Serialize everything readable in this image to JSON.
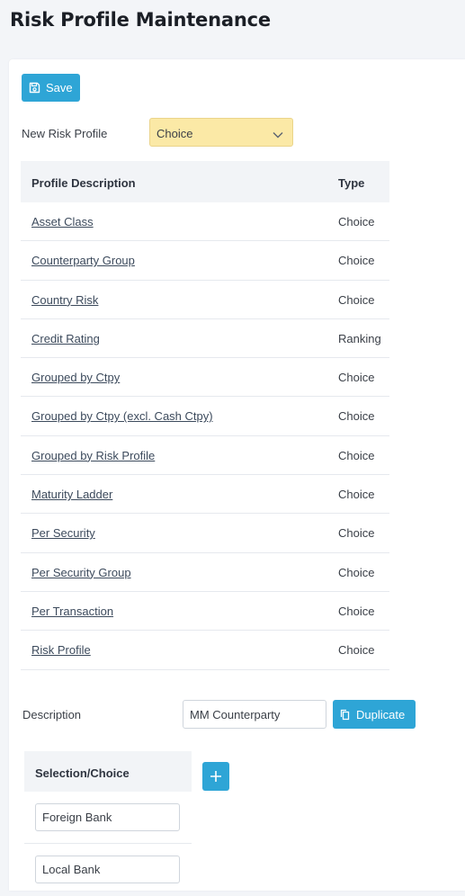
{
  "page": {
    "title": "Risk Profile Maintenance"
  },
  "toolbar": {
    "save_label": "Save",
    "save_icon": "floppy-disk-icon"
  },
  "new_profile": {
    "label": "New Risk Profile",
    "selected": "Choice",
    "icon": "chevron-down-icon"
  },
  "profiles": {
    "headers": {
      "description": "Profile Description",
      "type": "Type"
    },
    "rows": [
      {
        "description": "Asset Class",
        "type": "Choice"
      },
      {
        "description": "Counterparty Group",
        "type": "Choice"
      },
      {
        "description": "Country Risk",
        "type": "Choice"
      },
      {
        "description": "Credit Rating",
        "type": "Ranking"
      },
      {
        "description": "Grouped by Ctpy",
        "type": "Choice"
      },
      {
        "description": "Grouped by Ctpy (excl. Cash Ctpy)",
        "type": "Choice"
      },
      {
        "description": "Grouped by Risk Profile",
        "type": "Choice"
      },
      {
        "description": "Maturity Ladder",
        "type": "Choice"
      },
      {
        "description": "Per Security",
        "type": "Choice"
      },
      {
        "description": "Per Security Group",
        "type": "Choice"
      },
      {
        "description": "Per Transaction",
        "type": "Choice"
      },
      {
        "description": "Risk Profile",
        "type": "Choice"
      }
    ]
  },
  "detail": {
    "description_label": "Description",
    "description_value": "MM Counterparty",
    "duplicate_label": "Duplicate",
    "duplicate_icon": "copy-icon"
  },
  "selection": {
    "header": "Selection/Choice",
    "add_icon": "plus-icon",
    "items": [
      "Foreign Bank",
      "Local Bank"
    ]
  },
  "colors": {
    "accent": "#2ea5d6",
    "select_bg": "#fbe9a6",
    "header_bg": "#f2f4f7",
    "page_bg": "#f3f5f8"
  }
}
